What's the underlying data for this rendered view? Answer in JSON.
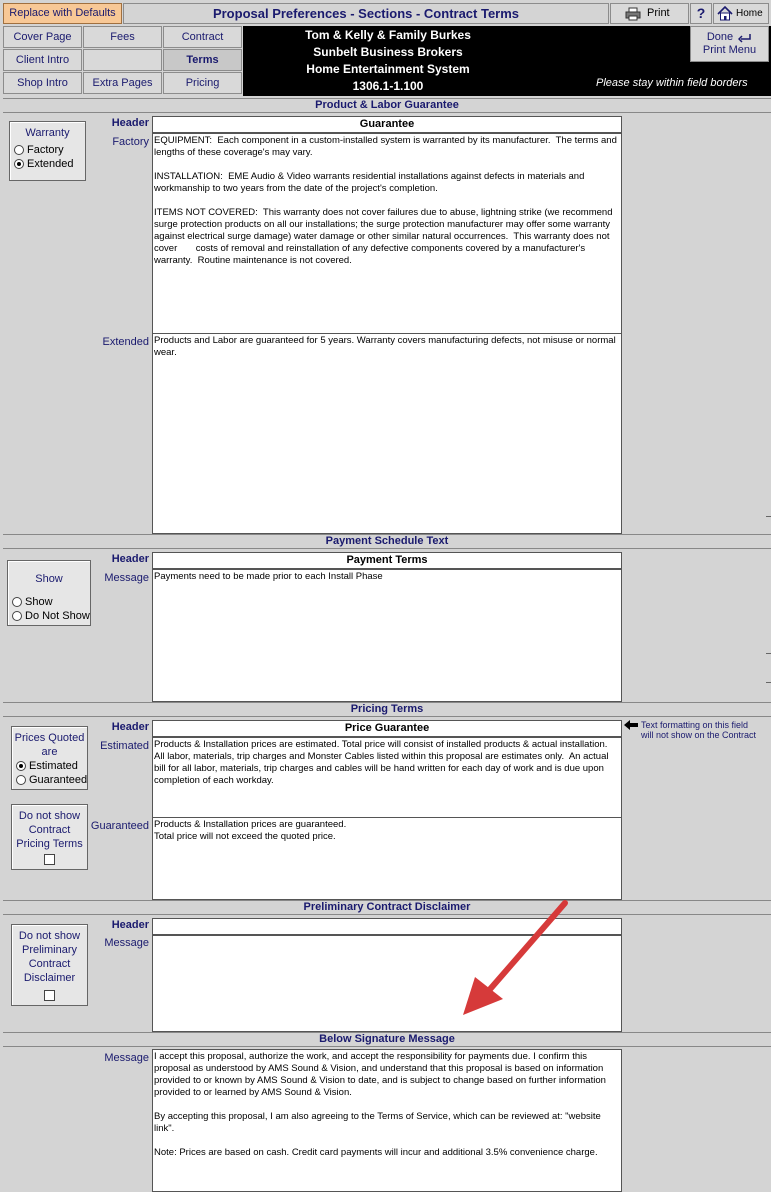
{
  "toolbar": {
    "replace_defaults": "Replace with Defaults",
    "title": "Proposal Preferences - Sections - Contract Terms",
    "print": "Print",
    "help": "?",
    "home": "Home",
    "done": "Done",
    "print_menu": "Print Menu"
  },
  "nav": [
    {
      "label": "Cover Page"
    },
    {
      "label": "Fees"
    },
    {
      "label": "Contract"
    },
    {
      "label": "Client Intro"
    },
    {
      "label": ""
    },
    {
      "label": "Terms"
    },
    {
      "label": "Shop Intro"
    },
    {
      "label": "Extra Pages"
    },
    {
      "label": "Pricing"
    }
  ],
  "client": {
    "line1": "Tom & Kelly & Family Burkes",
    "line2": "Sunbelt Business Brokers",
    "line3": "Home Entertainment System",
    "line4": "1306.1-1.100",
    "hint": "Please stay within field borders"
  },
  "guarantee": {
    "section": "Product & Labor Guarantee",
    "group_title": "Warranty",
    "options": [
      "Factory",
      "Extended"
    ],
    "selected": "Extended",
    "header_label": "Header",
    "header_value": "Guarantee",
    "factory_label": "Factory",
    "factory_text": "EQUIPMENT:  Each component in a custom-installed system is warranted by its manufacturer.  The terms and lengths of these coverage's may vary.\n\nINSTALLATION:  EME Audio & Video warrants residential installations against defects in materials and workmanship to two years from the date of the project's completion.\n\nITEMS NOT COVERED:  This warranty does not cover failures due to abuse, lightning strike (we recommend surge protection products on all our installations; the surge protection manufacturer may offer some warranty against electrical surge damage) water damage or other similar natural occurrences.  This warranty does not cover       costs of removal and reinstallation of any defective components covered by a manufacturer's warranty.  Routine maintenance is not covered.",
    "extended_label": "Extended",
    "extended_text": "Products and Labor are guaranteed for 5 years. Warranty covers manufacturing defects, not misuse or normal wear."
  },
  "payment": {
    "section": "Payment Schedule Text",
    "group_title": "Show",
    "options": [
      "Show",
      "Do Not Show"
    ],
    "header_label": "Header",
    "header_value": "Payment Terms",
    "message_label": "Message",
    "message_text": "Payments need to be made prior to each Install Phase"
  },
  "pricing": {
    "section": "Pricing Terms",
    "group_title_1": "Prices Quoted",
    "group_title_2": "are",
    "options": [
      "Estimated",
      "Guaranteed"
    ],
    "selected": "Estimated",
    "hide_title": [
      "Do not show",
      "Contract",
      "Pricing Terms"
    ],
    "header_label": "Header",
    "header_value": "Price Guarantee",
    "estimated_label": "Estimated",
    "estimated_text": "Products & Installation prices are estimated. Total price will consist of installed products & actual installation. All labor, materials, trip charges and Monster Cables listed within this proposal are estimates only.  An actual bill for all labor, materials, trip charges and cables will be hand written for each day of work and is due upon completion of each workday.",
    "guaranteed_label": "Guaranteed",
    "guaranteed_text": "Products & Installation prices are guaranteed.\nTotal price will not exceed the quoted price.",
    "note_line1": "Text formatting on this field",
    "note_line2": "will not show on the Contract"
  },
  "disclaimer": {
    "section": "Preliminary Contract Disclaimer",
    "hide_title": [
      "Do not show",
      "Preliminary",
      "Contract",
      "Disclaimer"
    ],
    "header_label": "Header",
    "header_value": "",
    "message_label": "Message",
    "message_text": ""
  },
  "signature": {
    "section": "Below Signature Message",
    "message_label": "Message",
    "message_text": "I accept this proposal, authorize the work, and accept the responsibility for payments due. I confirm this proposal as understood by AMS Sound & Vision, and understand that this proposal is based on information provided to or known by AMS Sound & Vision to date, and is subject to change based on further information provided to or learned by AMS Sound & Vision.\n\nBy accepting this proposal, I am also agreeing to the Terms of Service, which can be reviewed at: \"website link\".\n\nNote: Prices are based on cash. Credit card payments will incur and additional 3.5% convenience charge."
  },
  "colors": {
    "accent_orange": "#f8c896",
    "navy": "#1a1a6e",
    "arrow_red": "#d63a3a"
  }
}
